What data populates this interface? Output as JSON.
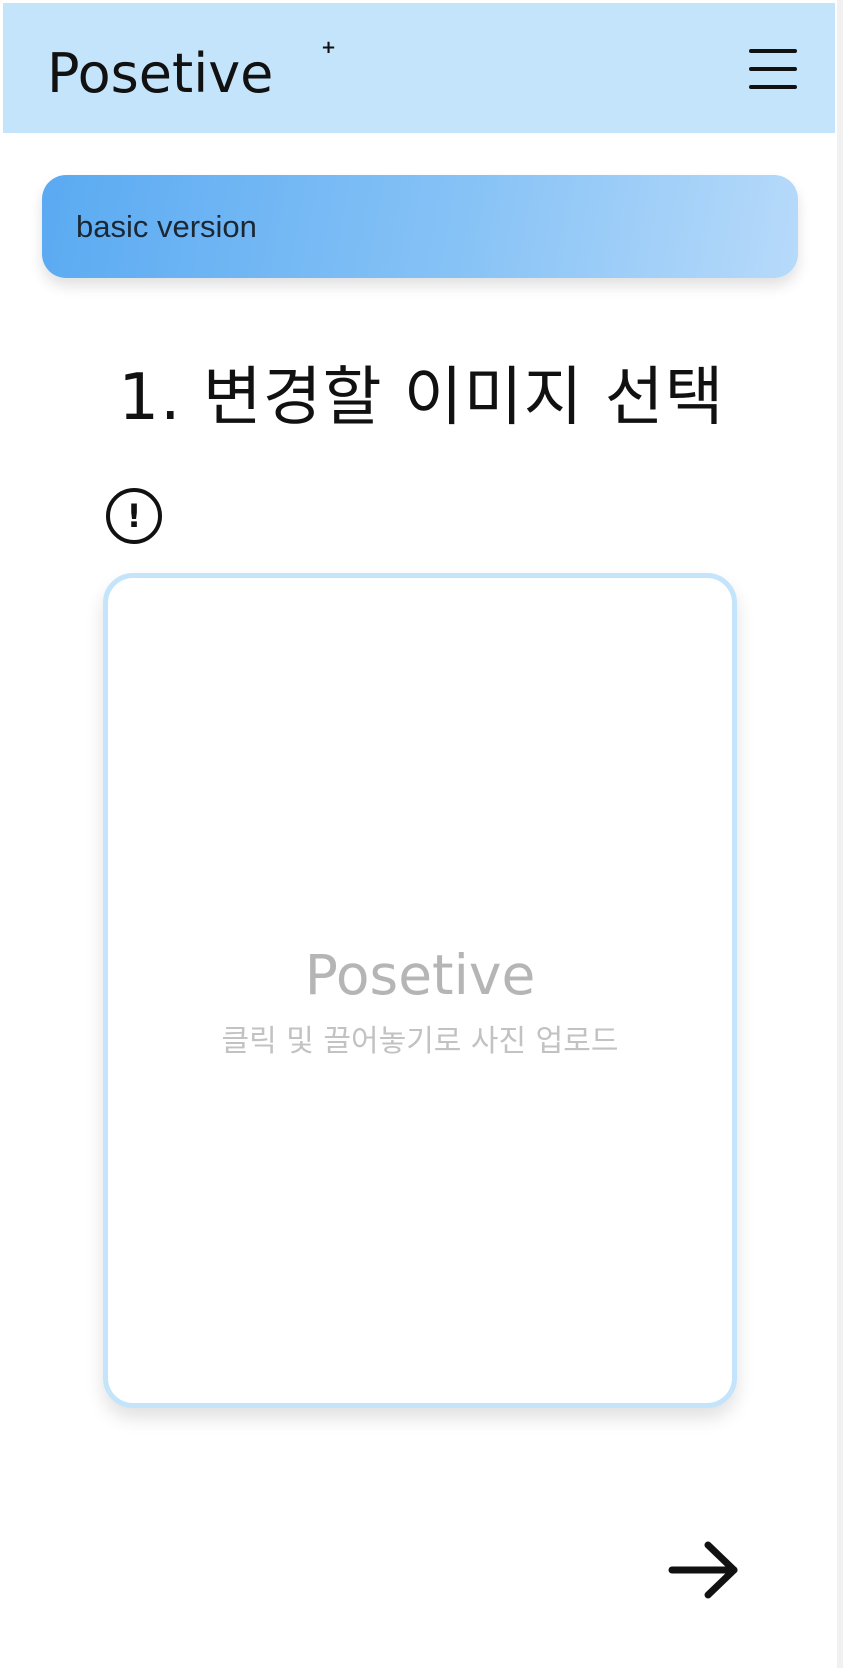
{
  "header": {
    "logo_text": "Posetive",
    "logo_plus": "+",
    "menu_icon": "hamburger-menu-icon",
    "background_color": "#c3e4fa"
  },
  "version": {
    "label": "basic version",
    "gradient_start": "#5aaaf2",
    "gradient_end": "#b7dafa"
  },
  "step": {
    "title": "1. 변경할 이미지 선택",
    "info_icon": "exclamation-circle-icon",
    "info_glyph": "!"
  },
  "upload": {
    "brand": "Posetive",
    "hint": "클릭 및 끌어놓기로 사진 업로드",
    "border_color": "#c4e4fb"
  },
  "navigation": {
    "next_icon": "arrow-right-icon"
  }
}
